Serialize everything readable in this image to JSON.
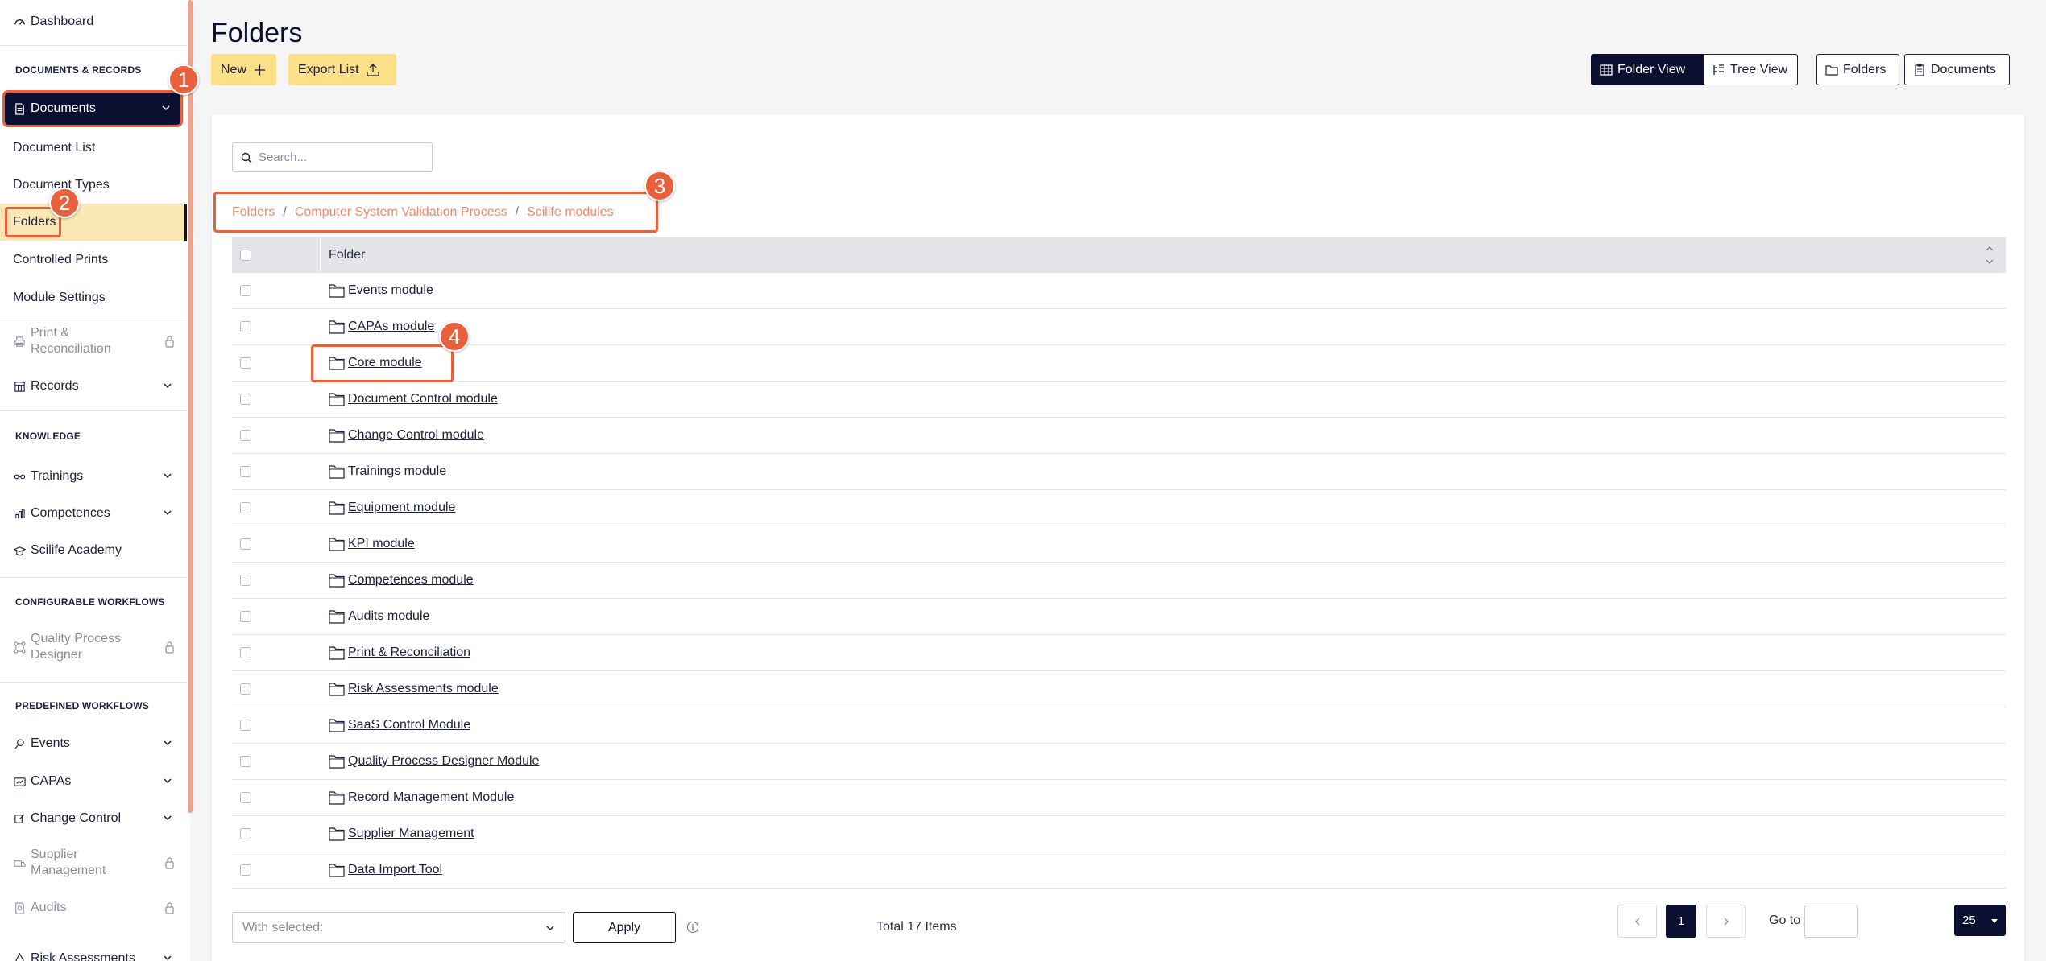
{
  "sidebar": {
    "dashboard": "Dashboard",
    "section_documents": "DOCUMENTS & RECORDS",
    "documents": "Documents",
    "document_list": "Document List",
    "document_types": "Document Types",
    "folders": "Folders",
    "controlled_prints": "Controlled Prints",
    "module_settings": "Module Settings",
    "print_reconciliation": "Print & Reconciliation",
    "records": "Records",
    "section_knowledge": "KNOWLEDGE",
    "trainings": "Trainings",
    "competences": "Competences",
    "scilife_academy": "Scilife Academy",
    "section_configurable": "CONFIGURABLE WORKFLOWS",
    "quality_process_designer": "Quality Process Designer",
    "section_predefined": "PREDEFINED WORKFLOWS",
    "events": "Events",
    "capas": "CAPAs",
    "change_control": "Change Control",
    "supplier_management": "Supplier Management",
    "audits": "Audits",
    "risk_assessments": "Risk Assessments"
  },
  "callouts": [
    "1",
    "2",
    "3",
    "4"
  ],
  "header": {
    "title": "Folders",
    "new_label": "New",
    "export_label": "Export List",
    "folder_view_label": "Folder View",
    "tree_view_label": "Tree View",
    "folders_label": "Folders",
    "documents_label": "Documents"
  },
  "search": {
    "placeholder": "Search..."
  },
  "breadcrumb": [
    "Folders",
    "Computer System Validation Process",
    "Scilife modules"
  ],
  "breadcrumb_separator": "/",
  "table": {
    "column_header": "Folder",
    "rows": [
      "Events module",
      "CAPAs module",
      "Core module",
      "Document Control module",
      "Change Control module",
      "Trainings module",
      "Equipment module",
      "KPI module",
      "Competences module",
      "Audits module",
      "Print & Reconciliation",
      "Risk Assessments module",
      "SaaS Control Module",
      "Quality Process Designer Module",
      "Record Management Module",
      "Supplier Management",
      "Data Import Tool"
    ]
  },
  "footer": {
    "with_selected_placeholder": "With selected:",
    "apply_label": "Apply",
    "total_items": "Total 17 Items",
    "current_page": "1",
    "goto_label": "Go to",
    "page_size": "25"
  },
  "colors": {
    "navy": "#0c1030",
    "accent_orange": "#e8603c",
    "highlight_yellow": "#fbe7b5",
    "button_yellow": "#fbe088",
    "breadcrumb_text": "#f0886a"
  }
}
